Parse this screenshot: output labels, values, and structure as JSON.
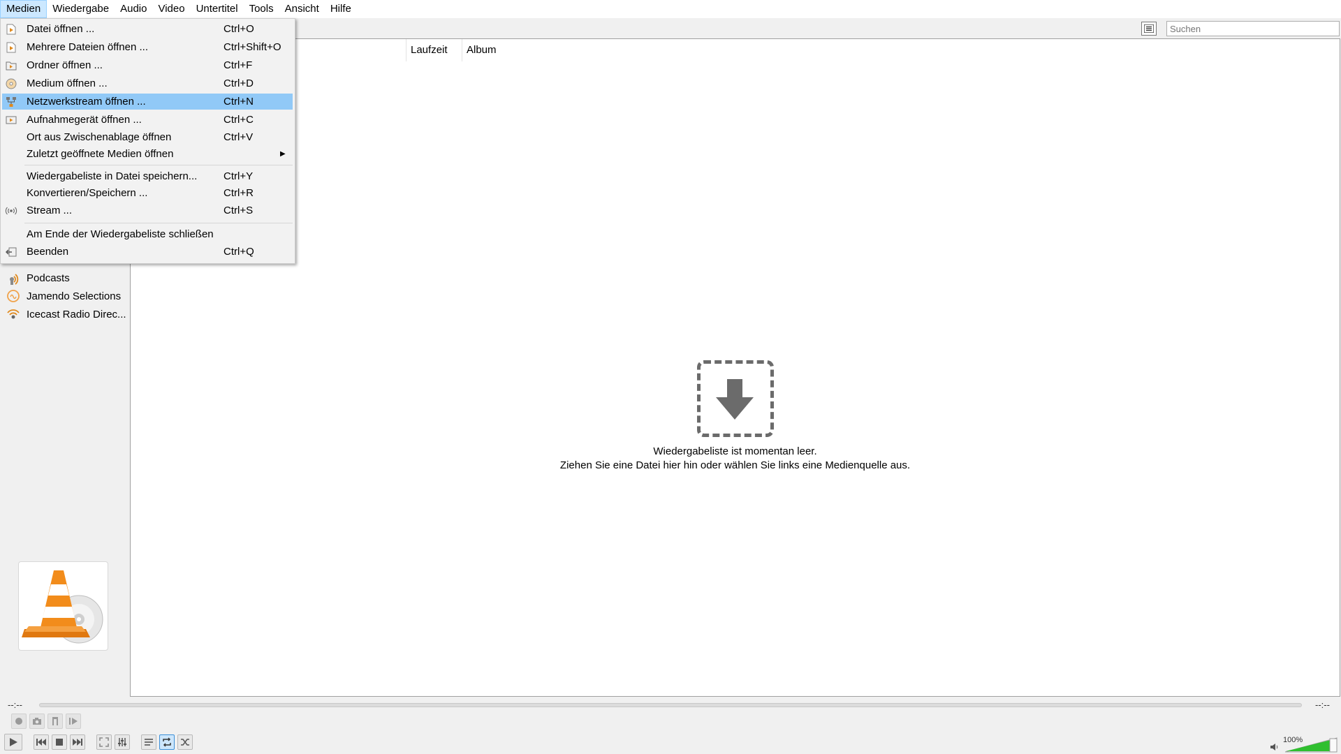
{
  "menubar": [
    "Medien",
    "Wiedergabe",
    "Audio",
    "Video",
    "Untertitel",
    "Tools",
    "Ansicht",
    "Hilfe"
  ],
  "search": {
    "placeholder": "Suchen"
  },
  "columns": {
    "duration": "Laufzeit",
    "album": "Album"
  },
  "sidebar": {
    "items": [
      {
        "label": "Podcasts",
        "icon": "podcast-icon"
      },
      {
        "label": "Jamendo Selections",
        "icon": "jamendo-icon"
      },
      {
        "label": "Icecast Radio Direc...",
        "icon": "icecast-icon"
      }
    ]
  },
  "empty": {
    "line1": "Wiedergabeliste ist momentan leer.",
    "line2": "Ziehen Sie eine Datei hier hin oder wählen Sie links eine Medienquelle aus."
  },
  "media_menu": {
    "items": [
      {
        "label": "Datei öffnen ...",
        "shortcut": "Ctrl+O",
        "icon": "file-icon"
      },
      {
        "label": "Mehrere Dateien öffnen ...",
        "shortcut": "Ctrl+Shift+O",
        "icon": "files-icon"
      },
      {
        "label": "Ordner öffnen ...",
        "shortcut": "Ctrl+F",
        "icon": "folder-icon"
      },
      {
        "label": "Medium öffnen ...",
        "shortcut": "Ctrl+D",
        "icon": "disc-icon"
      },
      {
        "label": "Netzwerkstream öffnen ...",
        "shortcut": "Ctrl+N",
        "icon": "network-icon",
        "highlighted": true
      },
      {
        "label": "Aufnahmegerät öffnen ...",
        "shortcut": "Ctrl+C",
        "icon": "capture-icon"
      },
      {
        "label": "Ort aus Zwischenablage öffnen",
        "shortcut": "Ctrl+V",
        "icon": ""
      },
      {
        "label": "Zuletzt geöffnete Medien öffnen",
        "shortcut": "",
        "icon": "",
        "submenu": true
      },
      {
        "label": "Wiedergabeliste in Datei speichern...",
        "shortcut": "Ctrl+Y",
        "icon": ""
      },
      {
        "label": "Konvertieren/Speichern ...",
        "shortcut": "Ctrl+R",
        "icon": ""
      },
      {
        "label": "Stream ...",
        "shortcut": "Ctrl+S",
        "icon": "stream-icon"
      },
      {
        "label": "Am Ende der Wiedergabeliste schließen",
        "shortcut": "",
        "icon": ""
      },
      {
        "label": "Beenden",
        "shortcut": "Ctrl+Q",
        "icon": "quit-icon"
      }
    ]
  },
  "player": {
    "time_elapsed": "--:--",
    "time_total": "--:--",
    "volume": "100%",
    "volume_level": 1.0
  },
  "colors": {
    "highlight": "#91c9f7",
    "vlc_orange": "#f28c1b",
    "volume_green": "#2fbf2f"
  }
}
